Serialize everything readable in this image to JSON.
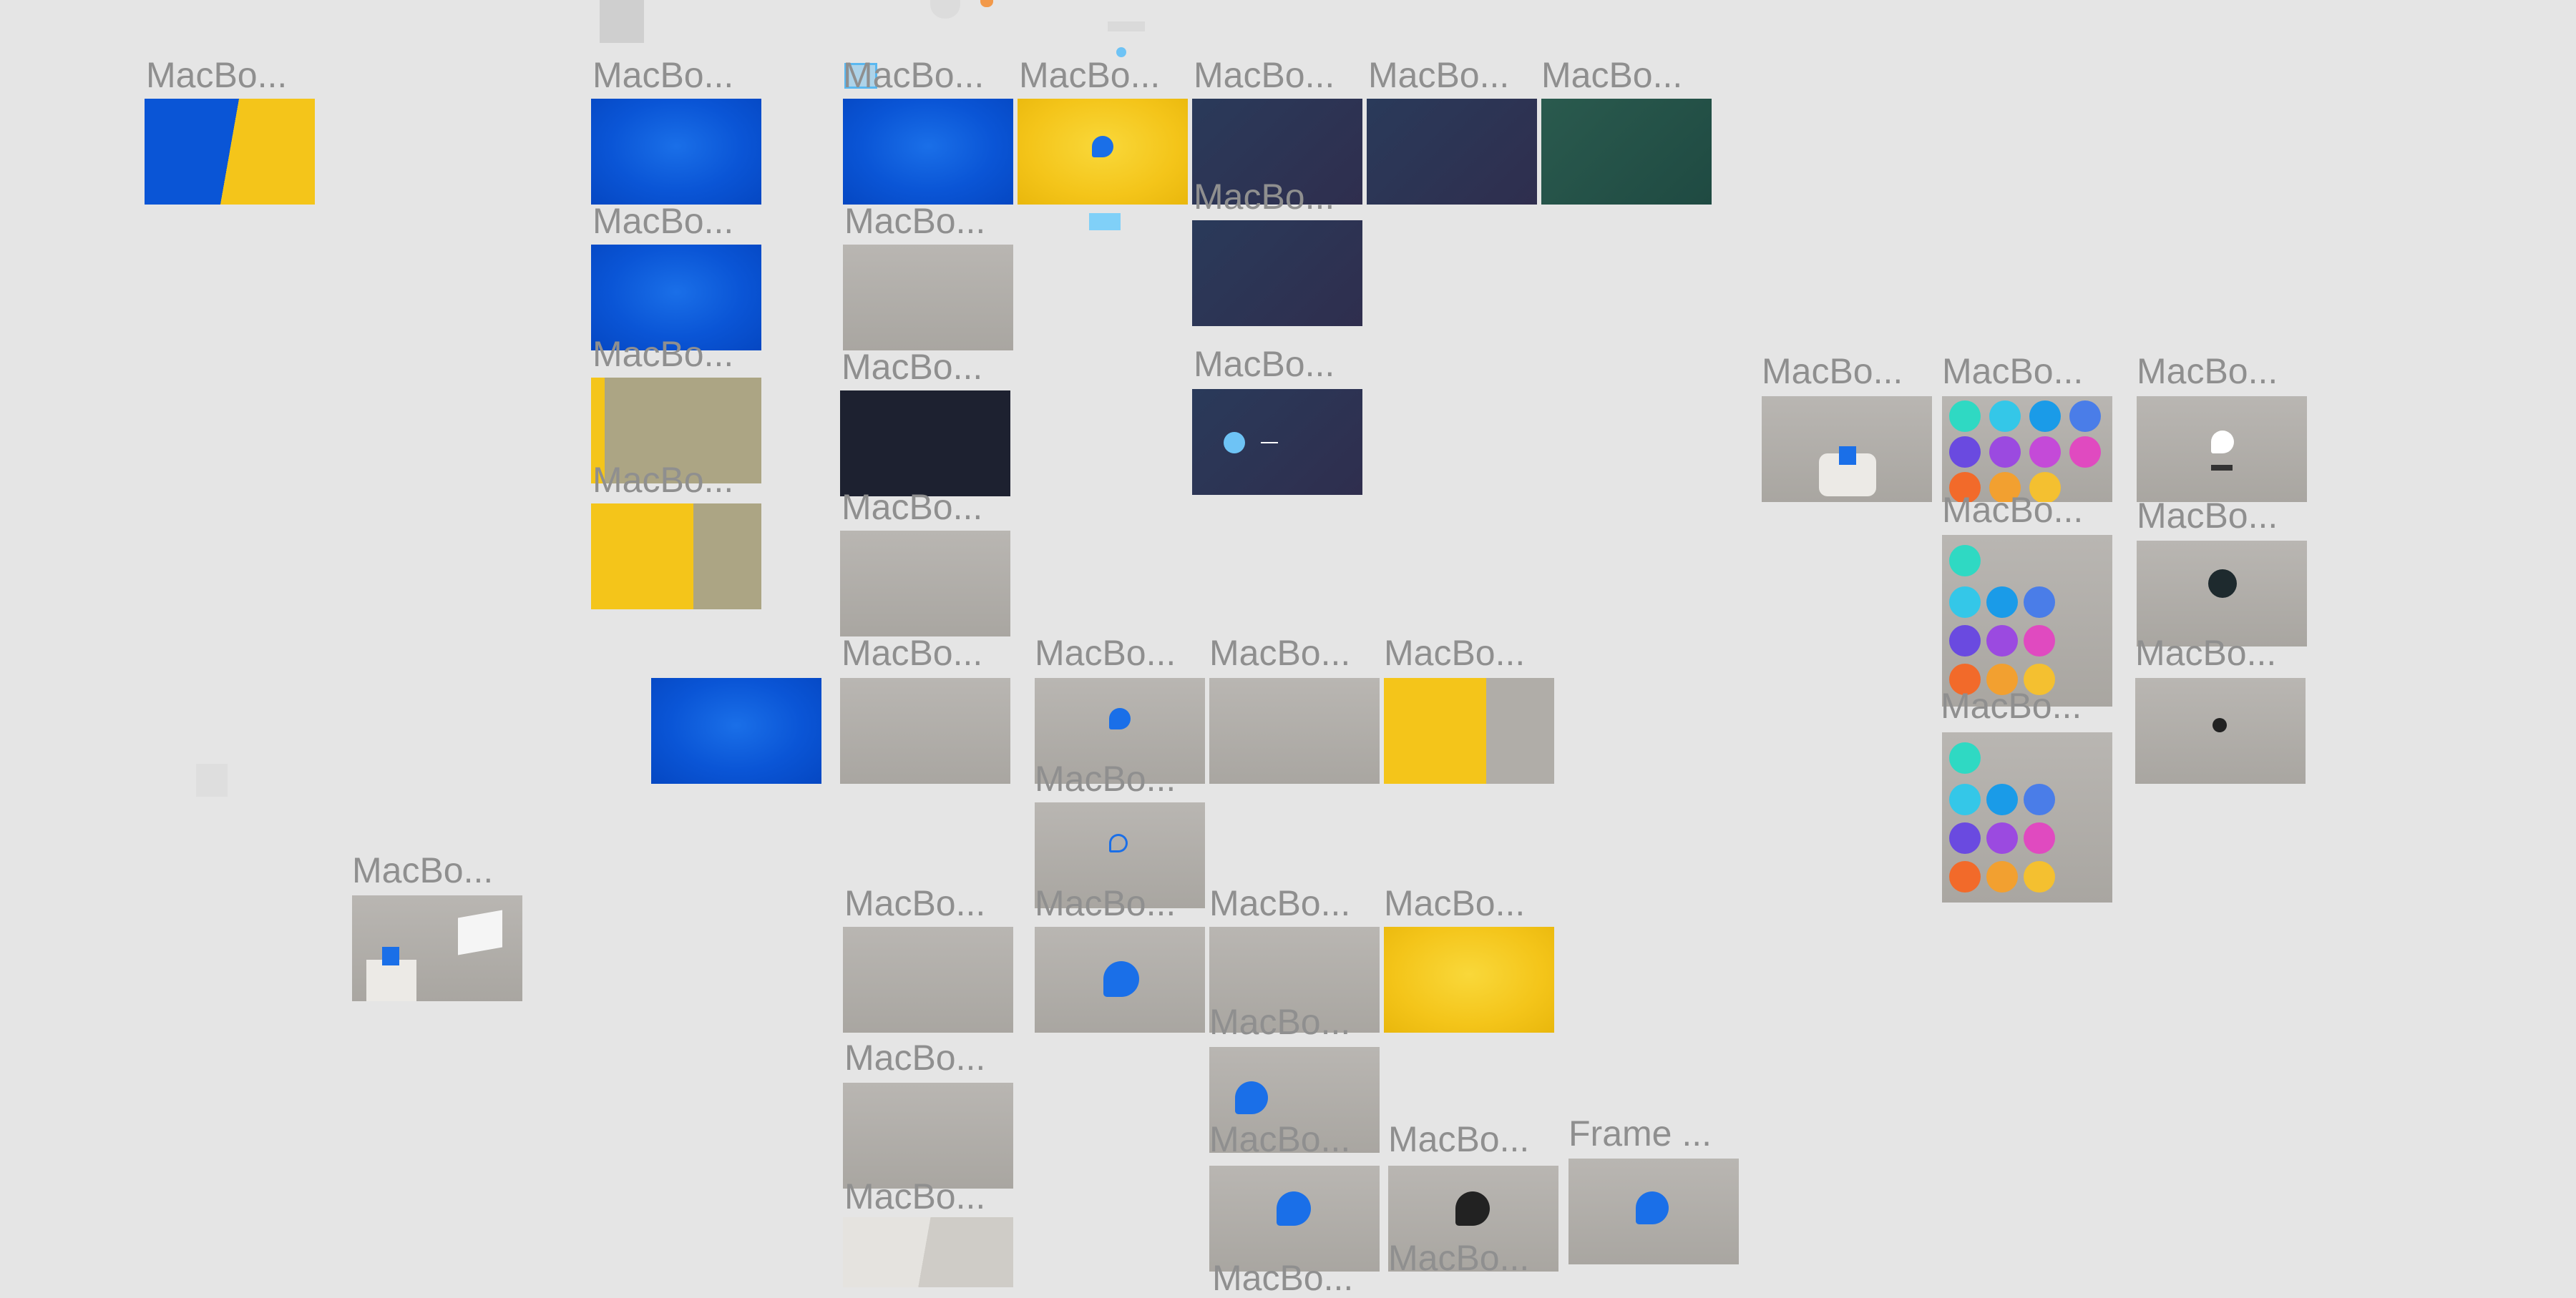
{
  "frames": {
    "f01": "MacBo...",
    "f02": "MacBo...",
    "f03": "MacBo...",
    "f04": "MacBo...",
    "f05": "MacBo...",
    "f06": "MacBo...",
    "f07": "MacBo...",
    "f08": "MacBo...",
    "f09": "MacBo...",
    "f10": "MacBo...",
    "f11": "MacBo...",
    "f12": "MacBo...",
    "f13": "MacBo...",
    "f14": "MacBo...",
    "f15": "MacBo...",
    "f16": "MacBo...",
    "f17": "MacBo...",
    "f18": "MacBo...",
    "f19": "MacBo...",
    "f20": "MacBo...",
    "f21": "MacBo...",
    "f22": "MacBo...",
    "f23": "MacBo...",
    "f24": "MacBo...",
    "f25": "MacBo...",
    "f26": "MacBo...",
    "f27": "MacBo...",
    "f28": "MacBo...",
    "f29": "MacBo...",
    "f30": "MacBo...",
    "f31": "MacBo...",
    "f32": "MacBo...",
    "f33": "MacBo...",
    "f34": "MacBo...",
    "f35": "MacBo...",
    "f36": "MacBo...",
    "f37": "MacBo...",
    "f38": "Frame ...",
    "f39": "MacBo..."
  },
  "colors": {
    "canvas": "#e5e5e5",
    "blue": "#0a55d6",
    "yellow": "#f4c51a",
    "grey": "#b0ada8",
    "navy": "#2e3250",
    "label": "#8f8f8f"
  }
}
